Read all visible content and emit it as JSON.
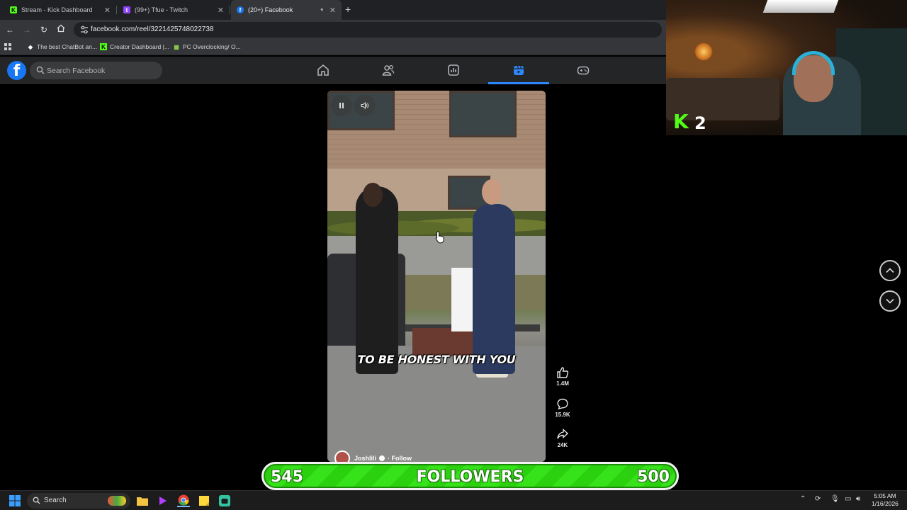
{
  "browser": {
    "tabs": [
      {
        "title": "Stream - Kick Dashboard",
        "icon": "kick-icon",
        "color": "#53fc18"
      },
      {
        "title": "(99+) Tfue - Twitch",
        "icon": "twitch-icon",
        "color": "#9146ff"
      },
      {
        "title": "(20+) Facebook",
        "icon": "facebook-icon",
        "color": "#1877f2",
        "active": true
      }
    ],
    "url": "facebook.com/reel/3221425748022738",
    "bookmarks": [
      {
        "label": "The best ChatBot an...",
        "icon": "chatbot-icon"
      },
      {
        "label": "Creator Dashboard |...",
        "icon": "kick-icon"
      },
      {
        "label": "PC Overclocking/ O...",
        "icon": "overclock-icon"
      }
    ]
  },
  "facebook": {
    "logo": "f",
    "search_placeholder": "Search Facebook",
    "nav": [
      "home-icon",
      "friends-icon",
      "dashboard-icon",
      "video-icon",
      "gaming-icon"
    ],
    "active_nav": "video-icon",
    "accent": "#2d88ff"
  },
  "reel": {
    "caption": "TO BE HONEST WITH YOU",
    "author": "Joshlili",
    "follow_label": "· Follow",
    "likes": "1.4M",
    "comments": "15.9K",
    "shares": "24K"
  },
  "webcam": {
    "kick_count": "2"
  },
  "followers_bar": {
    "current": "545",
    "label": "FOLLOWERS",
    "goal": "500",
    "color": "#36e31a"
  },
  "taskbar": {
    "search_placeholder": "Search",
    "time": "5:05 AM",
    "date": "1/16/2026"
  }
}
